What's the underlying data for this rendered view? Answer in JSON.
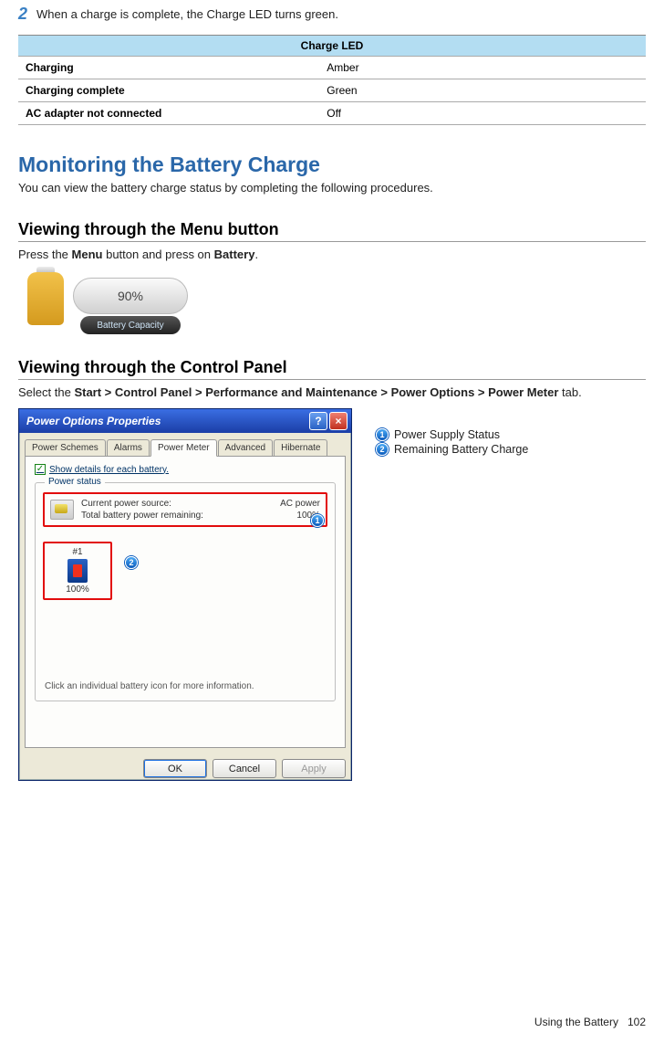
{
  "step": {
    "number": "2",
    "text": "When a charge is complete, the Charge LED turns green."
  },
  "led_table": {
    "header": "Charge LED",
    "rows": [
      {
        "state": "Charging",
        "value": "Amber"
      },
      {
        "state": "Charging complete",
        "value": "Green"
      },
      {
        "state": "AC adapter not connected",
        "value": "Off"
      }
    ]
  },
  "section": {
    "title": "Monitoring the Battery Charge",
    "subtitle": "You can view the battery charge status by completing the following procedures."
  },
  "view_menu": {
    "title": "Viewing through the Menu button",
    "text_pre": "Press the ",
    "text_bold1": "Menu",
    "text_mid": " button and press on ",
    "text_bold2": "Battery",
    "text_end": ".",
    "capacity_percent": "90%",
    "capacity_label": "Battery Capacity"
  },
  "view_panel": {
    "title": "Viewing through the Control Panel",
    "text_pre": "Select the ",
    "path": "Start > Control Panel > Performance and Maintenance > Power Options > Power Meter",
    "text_end": " tab."
  },
  "dialog": {
    "title": "Power Options Properties",
    "tabs": [
      "Power Schemes",
      "Alarms",
      "Power Meter",
      "Advanced",
      "Hibernate"
    ],
    "checkbox": "Show details for each battery.",
    "group_title": "Power status",
    "status": {
      "source_label": "Current power source:",
      "source_value": "AC power",
      "remain_label": "Total battery power remaining:",
      "remain_value": "100%"
    },
    "battery1": {
      "label": "#1",
      "percent": "100%"
    },
    "note": "Click an individual battery icon for more information.",
    "buttons": {
      "ok": "OK",
      "cancel": "Cancel",
      "apply": "Apply"
    }
  },
  "legend": {
    "item1": "Power Supply Status",
    "item2": "Remaining Battery Charge"
  },
  "footer": {
    "section": "Using the Battery",
    "page": "102"
  }
}
